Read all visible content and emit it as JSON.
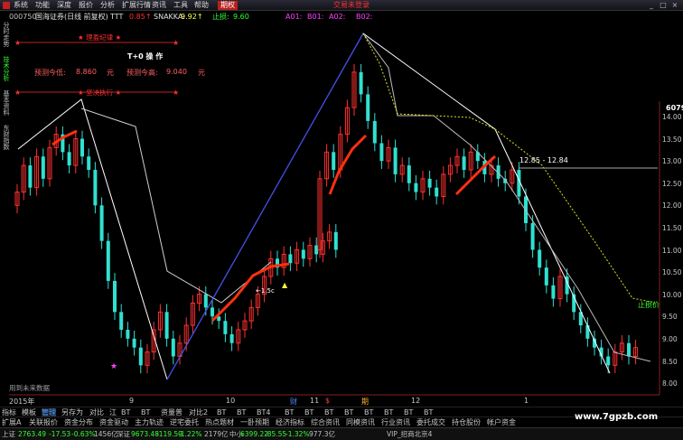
{
  "menu": {
    "items": [
      "系统",
      "功能",
      "深度",
      "报价",
      "分析",
      "扩展行情",
      "资讯",
      "工具",
      "帮助"
    ],
    "active": "期权",
    "warning": "交易未登录"
  },
  "window_controls": [
    "_",
    "□",
    "×"
  ],
  "headline": {
    "code": "000750",
    "name": "国海证券(日线 前复权)",
    "ttt_label": "TTT",
    "ttt_value": "0.85↑",
    "snakka_label": "SNAKKA:",
    "snakka_value": "9.92↑",
    "stop_label": "止损:",
    "stop_value": "9.60",
    "a01": "A01:",
    "b01": "B01:",
    "a02": "A02:",
    "b02": "B02:"
  },
  "side_tabs": [
    "分时走势",
    "技术分析",
    "基本资料",
    "东财指数"
  ],
  "panel": {
    "title1": "★ 理盈纪律 ★",
    "tplus": "T+0 操 作",
    "low_label": "预测今低:",
    "low_value": "8.860",
    "unit1": "元",
    "high_label": "预测今高:",
    "high_value": "9.040",
    "unit2": "元",
    "title2": "★ 坚决执行 ★"
  },
  "price_axis": {
    "top": "6079",
    "labels": [
      "14.00",
      "13.50",
      "13.00",
      "12.50",
      "12.00",
      "11.50",
      "11.00",
      "10.50",
      "10.00",
      "9.50",
      "9.00",
      "8.50",
      "8.00"
    ]
  },
  "price_box": "12.85 - 12.84",
  "stop_mark": "止损价",
  "arrow_label": "←1.5c",
  "footnote": "用到未来数据",
  "x_axis": {
    "year": "2015年",
    "months": [
      "9",
      "10",
      "11",
      "12",
      "1"
    ],
    "badges": [
      {
        "text": "财",
        "color": "#4a8cff"
      },
      {
        "text": "$",
        "color": "#ff4040"
      },
      {
        "text": "期",
        "color": "#ffb020"
      }
    ]
  },
  "tabs_row1": [
    "指标",
    "模板",
    "管理",
    "另存为",
    "对比",
    "江",
    "BT",
    "BT",
    "资量普",
    "对比2",
    "BT",
    "BT",
    "BT4",
    "BT",
    "BT",
    "BT",
    "BT",
    "BT",
    "BT",
    "BT",
    "BT"
  ],
  "tabs_row2": [
    "扩展A",
    "关联报价",
    "资金分布",
    "资金驱动",
    "主力轨迹",
    "逆宅委托",
    "热点题材",
    "一卧预期",
    "经济指标",
    "综合资讯",
    "同模资讯",
    "行业资讯",
    "委托成交",
    "持仓股份",
    "帐户资金"
  ],
  "status": {
    "sh_label": "上证",
    "sh_value": "2763.49",
    "sh_change": "-17.53",
    "sh_pct": "-0.63%",
    "sh_amount": "1456亿",
    "sz_label": "深证",
    "sz_value": "9673.48",
    "sz_change": "-119.59",
    "sz_pct": "-1.22%",
    "sz_amount": "2179亿",
    "zx_label": "中小",
    "zx_value": "6399.22",
    "zx_change": "-85.55",
    "zx_pct": "-1.32%",
    "zx_amount": "977.3亿",
    "vip": "VIP_招商北京4"
  },
  "watermark": "www.7gpzb.com",
  "colors": {
    "up": "#ff3030",
    "down": "#30e0d0",
    "ma_red": "#ff3010",
    "white_line": "#ffffff",
    "blue_line": "#3040ff",
    "yellow_line": "#e0e020",
    "menu_active": "#b81e1e"
  }
}
